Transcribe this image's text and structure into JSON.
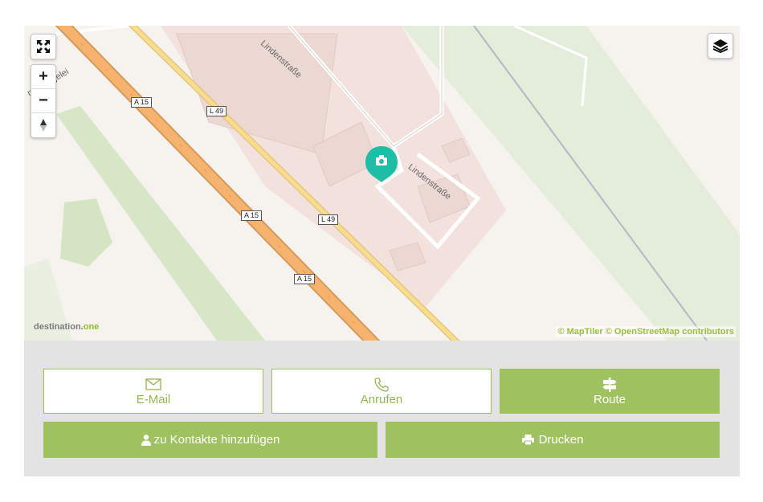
{
  "map": {
    "road_labels": [
      "A 15",
      "L 49",
      "A 15",
      "L 49",
      "A 15"
    ],
    "street_names": [
      "Lindenstraße",
      "Lindenstraße",
      "ner Ziegelei"
    ],
    "brand": {
      "part1": "destination.",
      "part2": "one"
    },
    "attribution": "© MapTiler © OpenStreetMap contributors",
    "controls": {
      "fullscreen_icon": "fullscreen-icon",
      "zoom_in": "+",
      "zoom_out": "−",
      "north_icon": "compass-icon",
      "layers_icon": "layers-icon"
    },
    "marker_icon": "camera-icon",
    "colors": {
      "marker": "#1bbfa6",
      "highway": "#f5b36f",
      "accent": "#a0c15f"
    }
  },
  "actions": {
    "email": {
      "label": "E-Mail",
      "icon": "envelope-icon"
    },
    "call": {
      "label": "Anrufen",
      "icon": "phone-icon"
    },
    "route": {
      "label": "Route",
      "icon": "signpost-icon"
    },
    "contacts": {
      "label": "zu Kontakte hinzufügen",
      "icon": "user-icon"
    },
    "print": {
      "label": "Drucken",
      "icon": "print-icon"
    }
  }
}
